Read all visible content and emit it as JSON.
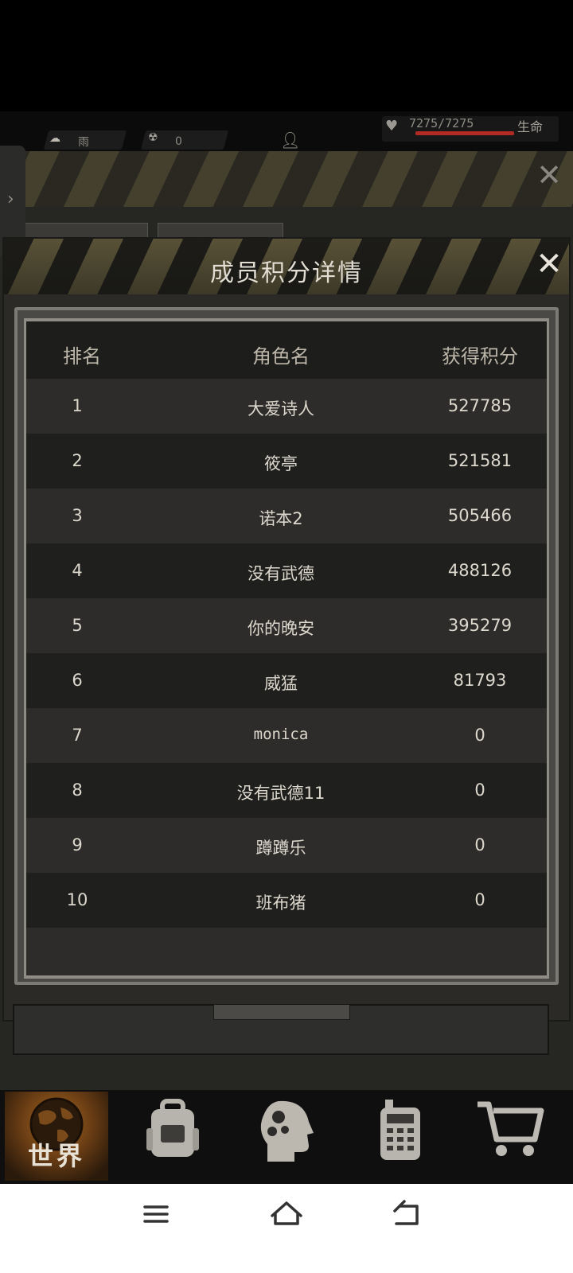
{
  "hud": {
    "weather_label": "雨",
    "radiation_value": "0",
    "health_value": "7275/7275",
    "health_label": "生命",
    "health_fraction": 1.0,
    "health_color": "#b12b24"
  },
  "popup": {
    "title": "成员积分详情",
    "close_icon": "close-icon",
    "columns": {
      "rank": "排名",
      "name": "角色名",
      "points": "获得积分"
    },
    "rows": [
      {
        "rank": "1",
        "name": "大爱诗人",
        "points": "527785"
      },
      {
        "rank": "2",
        "name": "筱亭",
        "points": "521581"
      },
      {
        "rank": "3",
        "name": "诺本2",
        "points": "505466"
      },
      {
        "rank": "4",
        "name": "没有武德",
        "points": "488126"
      },
      {
        "rank": "5",
        "name": "你的晚安",
        "points": "395279"
      },
      {
        "rank": "6",
        "name": "威猛",
        "points": "81793"
      },
      {
        "rank": "7",
        "name": "monica",
        "points": "0"
      },
      {
        "rank": "8",
        "name": "没有武德11",
        "points": "0"
      },
      {
        "rank": "9",
        "name": "蹲蹲乐",
        "points": "0"
      },
      {
        "rank": "10",
        "name": "班布猪",
        "points": "0"
      }
    ]
  },
  "nav": {
    "items": [
      {
        "label": "世界",
        "icon": "globe-icon",
        "active": true
      },
      {
        "icon": "backpack-icon"
      },
      {
        "icon": "brain-gear-icon"
      },
      {
        "icon": "radio-icon"
      },
      {
        "icon": "shopping-cart-icon"
      }
    ]
  },
  "system_bar": {
    "icons": [
      "menu-icon",
      "home-icon",
      "back-icon"
    ]
  },
  "colors": {
    "accent_stripe": "#6f6643",
    "table_bg": "#262625",
    "nav_active": "#a86a21"
  }
}
